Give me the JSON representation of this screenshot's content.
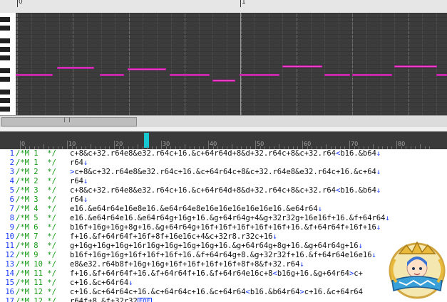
{
  "ruler_top": {
    "markers": [
      "0",
      "1"
    ]
  },
  "mml_ruler": {
    "numbers": [
      "0",
      "10",
      "20",
      "30",
      "40",
      "50",
      "60",
      "70",
      "80"
    ]
  },
  "editor": {
    "lines": [
      {
        "num": "1",
        "comment": "/*M 1  */",
        "code": "c+8&c+32.r64e8&e32.r64c+16.&c+64r64d+8&d+32.r64c+8&c+32.r64",
        "br": "<",
        "tail": "b16.&b64",
        "eol": "↓"
      },
      {
        "num": "2",
        "comment": "/*M 1  */",
        "code": "r64",
        "br": "",
        "tail": "",
        "eol": "↓"
      },
      {
        "num": "3",
        "comment": "/*M 2  */",
        "code": "",
        "br": ">",
        "tail": "c+8&c+32.r64e8&e32.r64c+16.&c+64r64c+8&c+32.r64e8&e32.r64c+16.&c+64",
        "eol": "↓"
      },
      {
        "num": "4",
        "comment": "/*M 2  */",
        "code": "r64",
        "br": "",
        "tail": "",
        "eol": "↓"
      },
      {
        "num": "5",
        "comment": "/*M 3  */",
        "code": "c+8&c+32.r64e8&e32.r64c+16.&c+64r64d+8&d+32.r64c+8&c+32.r64",
        "br": "<",
        "tail": "b16.&b64",
        "eol": "↓"
      },
      {
        "num": "6",
        "comment": "/*M 3  */",
        "code": "r64",
        "br": "",
        "tail": "",
        "eol": "↓"
      },
      {
        "num": "7",
        "comment": "/*M 4  */",
        "code": "e16.&e64r64e16e8e16.&e64r64e8e16e16e16e16e16e16.&e64r64",
        "br": "",
        "tail": "",
        "eol": "↓"
      },
      {
        "num": "8",
        "comment": "/*M 5  */",
        "code": "e16.&e64r64e16.&e64r64g+16g+16.&g+64r64g+4&g+32r32g+16e16f+16.&f+64r64",
        "br": "",
        "tail": "",
        "eol": "↓"
      },
      {
        "num": "9",
        "comment": "/*M 6  */",
        "code": "b16f+16g+16g+8g+16.&g+64r64g+16f+16f+16f+16f+16f+16.&f+64r64f+16f+16",
        "br": "",
        "tail": "",
        "eol": "↓"
      },
      {
        "num": "10",
        "comment": "/*M 7  */",
        "code": "f+16.&f+64r64f+16f+8f+16e16c+4&c+32r8.r32c+16",
        "br": "",
        "tail": "",
        "eol": "↓"
      },
      {
        "num": "11",
        "comment": "/*M 8  */",
        "code": "g+16g+16g+16g+16r16g+16g+16g+16g+16.&g+64r64g+8g+16.&g+64r64g+16",
        "br": "",
        "tail": "",
        "eol": "↓"
      },
      {
        "num": "12",
        "comment": "/*M 9  */",
        "code": "b16f+16g+16g+16f+16f+16f+16.&f+64r64g+8.&g+32r32f+16.&f+64r64e16e16",
        "br": "",
        "tail": "",
        "eol": "↓"
      },
      {
        "num": "13",
        "comment": "/*M 10 */",
        "code": "e8&e32.r64b8f+16g+16g+16f+16f+16f+16f+8f+8&f+32.r64",
        "br": "",
        "tail": "",
        "eol": "↓"
      },
      {
        "num": "14",
        "comment": "/*M 11 */",
        "code": "f+16.&f+64r64f+16.&f+64r64f+16.&f+64r64e16c+8",
        "br": "<",
        "tail": "b16g+16.&g+64r64",
        "eol": ""
      },
      {
        "num": "15",
        "comment": "/*M 11 */",
        "code": "c+16.&c+64r64",
        "br": "",
        "tail": "",
        "eol": "↓"
      },
      {
        "num": "16",
        "comment": "/*M 12 */",
        "code": "c+16.&c+64r64c+16.&c+64r64c+16.&c+64r64",
        "br": "<",
        "tail": "b16.&b64r64",
        "eol": ""
      },
      {
        "num": "17",
        "comment": "/*M 12 */",
        "code": "r64f+8.&f+32r32",
        "br": "",
        "tail": "",
        "eol": "EOF"
      }
    ]
  },
  "line14_extra": {
    "br2": ">",
    "tail2": "c+"
  },
  "line16_extra": {
    "br2": ">",
    "tail2": "c+16.&c+64r64"
  },
  "colors": {
    "note": "#ff3fd0",
    "roll_bg": "#3c3c3c",
    "comment": "#159a15",
    "line_number": "#1a3cff",
    "cursor": "#18c8d0"
  },
  "icons": {
    "mascot": "mascot-badge-icon"
  }
}
